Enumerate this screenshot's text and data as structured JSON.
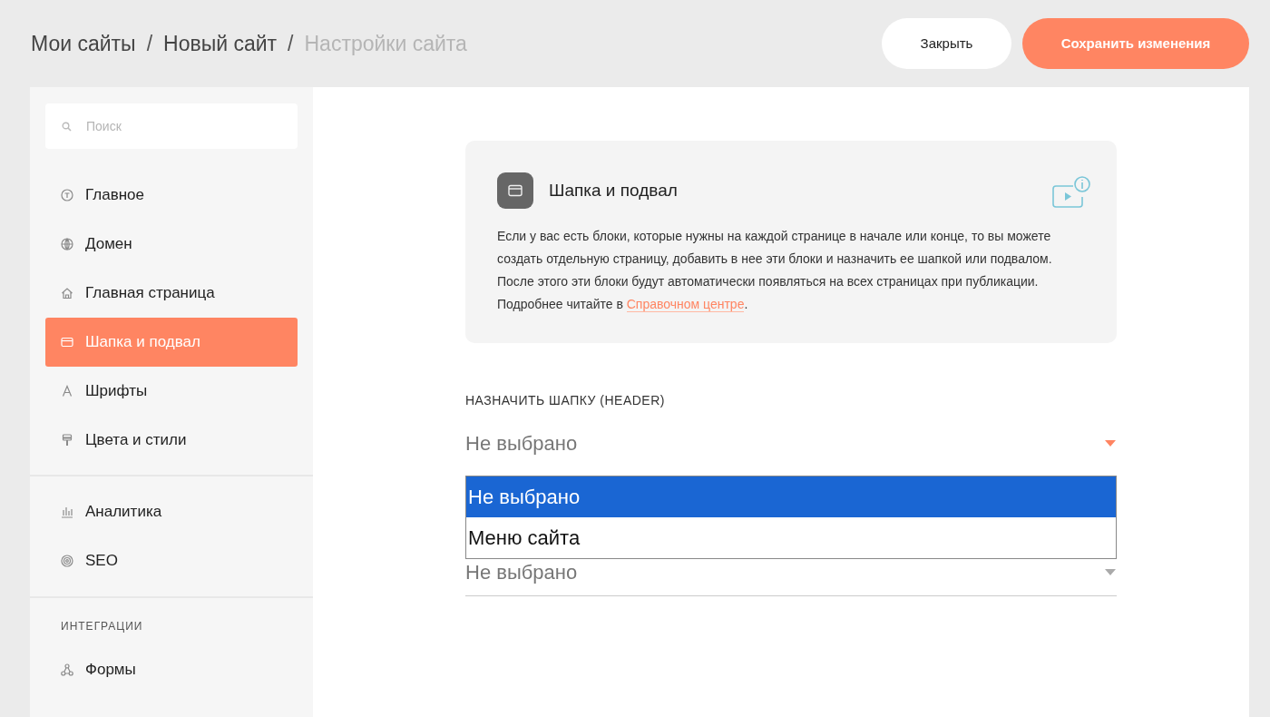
{
  "breadcrumbs": {
    "separator": "/",
    "items": [
      {
        "label": "Мои сайты",
        "current": false
      },
      {
        "label": "Новый сайт",
        "current": false
      },
      {
        "label": "Настройки сайта",
        "current": true
      }
    ]
  },
  "buttons": [
    {
      "label": "Закрыть",
      "kind": "secondary"
    },
    {
      "label": "Сохранить изменения",
      "kind": "primary"
    }
  ],
  "sidebar": {
    "search": {
      "placeholder": "Поиск"
    },
    "sections": [
      {
        "items": [
          {
            "label": "Главное",
            "selected": false
          },
          {
            "label": "Домен",
            "selected": false
          },
          {
            "label": "Главная страница",
            "selected": false
          },
          {
            "label": "Шапка и подвал",
            "selected": true
          },
          {
            "label": "Шрифты",
            "selected": false
          },
          {
            "label": "Цвета и стили",
            "selected": false
          }
        ]
      },
      {
        "items": [
          {
            "label": "Аналитика",
            "selected": false
          },
          {
            "label": "SEO",
            "selected": false
          }
        ]
      },
      {
        "heading": "ИНТЕГРАЦИИ",
        "items": [
          {
            "label": "Формы",
            "selected": false
          }
        ]
      }
    ]
  },
  "info_card": {
    "title": "Шапка и подвал",
    "text_before": "Если у вас есть блоки, которые нужны на каждой странице в начале или конце, то вы можете создать отдельную страницу, добавить в нее эти блоки и назначить ее шапкой или подвалом. После этого эти блоки будут автоматически появляться на всех страницах при публикации. Подробнее читайте в ",
    "link": "Справочном центре",
    "text_after": "."
  },
  "header_select": {
    "label": "НАЗНАЧИТЬ ШАПКУ (HEADER)",
    "value": "Не выбрано",
    "expanded": true,
    "options": [
      {
        "label": "Не выбрано",
        "selected": true
      },
      {
        "label": "Меню сайта",
        "selected": false
      }
    ]
  },
  "footer_select": {
    "value": "Не выбрано",
    "expanded": false
  }
}
